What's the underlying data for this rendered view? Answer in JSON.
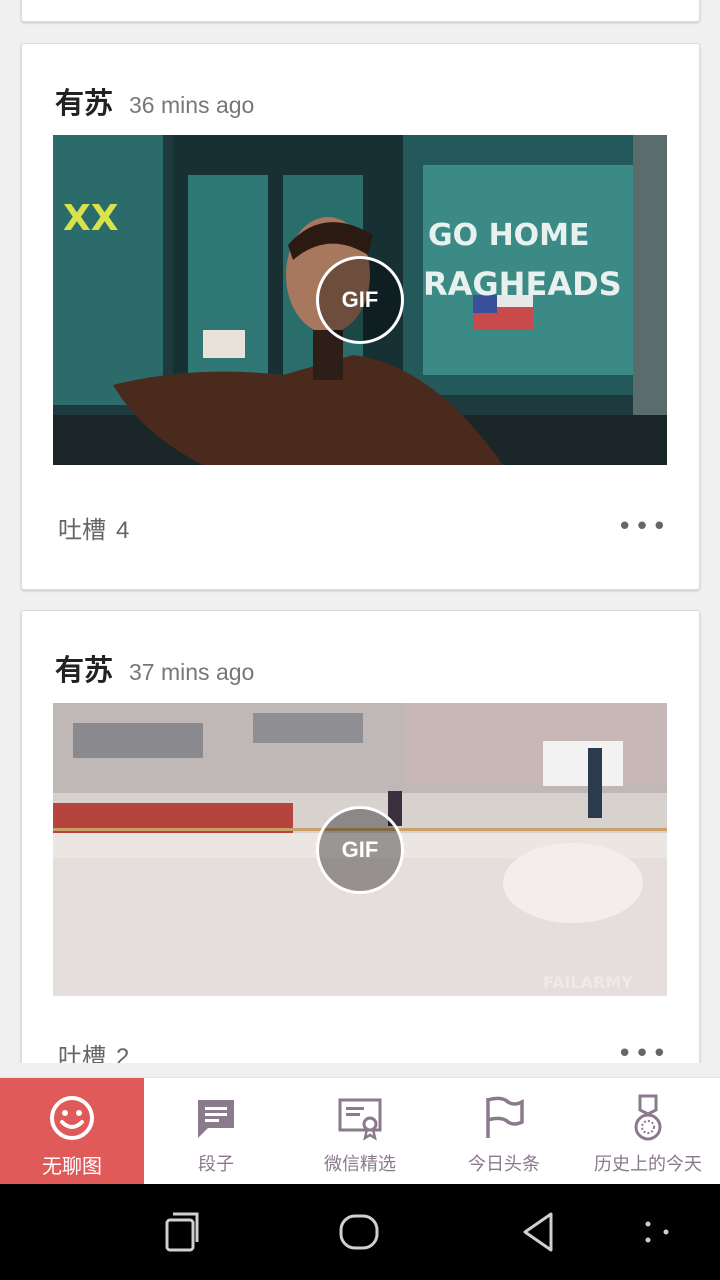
{
  "posts": [
    {
      "author": "有苏",
      "time": "36 mins ago",
      "badge": "GIF",
      "comment_label": "吐槽",
      "comment_count": "4",
      "more": "•••"
    },
    {
      "author": "有苏",
      "time": "37 mins ago",
      "badge": "GIF",
      "comment_label": "吐槽",
      "comment_count": "2",
      "more": "•••"
    }
  ],
  "tabs": [
    {
      "label": "无聊图",
      "icon": "smiley-icon",
      "active": true
    },
    {
      "label": "段子",
      "icon": "chat-bubble-icon",
      "active": false
    },
    {
      "label": "微信精选",
      "icon": "certificate-icon",
      "active": false
    },
    {
      "label": "今日头条",
      "icon": "flag-icon",
      "active": false
    },
    {
      "label": "历史上的今天",
      "icon": "medal-icon",
      "active": false
    }
  ],
  "colors": {
    "accent": "#e15a5a",
    "tab_inactive": "#8a7a8c"
  },
  "system_nav": [
    "recent-apps-icon",
    "home-icon",
    "back-icon",
    "menu-dots-icon"
  ]
}
